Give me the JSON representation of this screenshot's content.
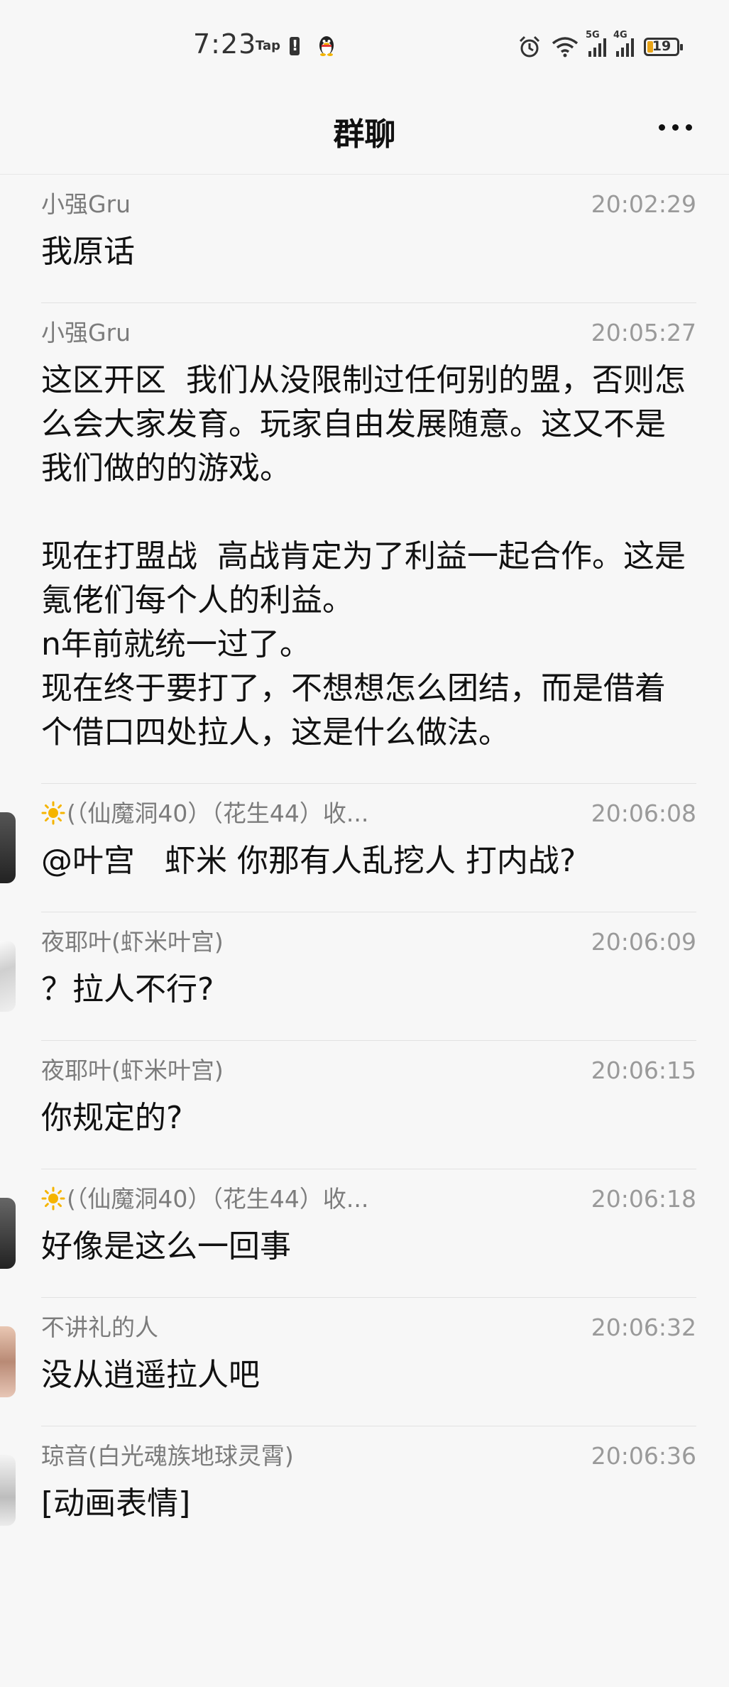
{
  "status_bar": {
    "time": "7:23",
    "tap_label": "Tap",
    "battery_level": "19",
    "signal_1_label": "5G",
    "signal_2_label": "4G"
  },
  "header": {
    "title": "群聊"
  },
  "messages": [
    {
      "name": "小强Gru",
      "time": "20:02:29",
      "text": "我原话",
      "avatar": "none"
    },
    {
      "name": "小强Gru",
      "time": "20:05:27",
      "text": "这区开区  我们从没限制过任何别的盟，否则怎么会大家发育。玩家自由发展随意。这又不是我们做的的游戏。\n\n现在打盟战  高战肯定为了利益一起合作。这是氪佬们每个人的利益。\nn年前就统一过了。\n现在终于要打了，不想想怎么团结，而是借着个借口四处拉人，这是什么做法。",
      "avatar": "none"
    },
    {
      "name": "(（仙魔洞40）（花生44）收...",
      "time": "20:06:08",
      "text": "@叶宫   虾米 你那有人乱挖人 打内战?",
      "avatar": "dark",
      "has_sun": true
    },
    {
      "name": "夜耶叶(虾米叶宫)",
      "time": "20:06:09",
      "text": "？拉人不行?",
      "avatar": "sketch"
    },
    {
      "name": "夜耶叶(虾米叶宫)",
      "time": "20:06:15",
      "text": "你规定的?",
      "avatar": "none"
    },
    {
      "name": "(（仙魔洞40）（花生44）收...",
      "time": "20:06:18",
      "text": "好像是这么一回事",
      "avatar": "dark",
      "has_sun": true
    },
    {
      "name": "不讲礼的人",
      "time": "20:06:32",
      "text": "没从逍遥拉人吧",
      "avatar": "face"
    },
    {
      "name": "琼音(白光魂族地球灵霄)",
      "time": "20:06:36",
      "text": "[动画表情]",
      "avatar": "light"
    }
  ],
  "colors": {
    "background": "#f7f7f7",
    "divider": "#e2e2e2",
    "name_text": "#7c7c7c",
    "time_text": "#9a9a9a",
    "message_text": "#111111",
    "battery_fill": "#e8a317"
  }
}
